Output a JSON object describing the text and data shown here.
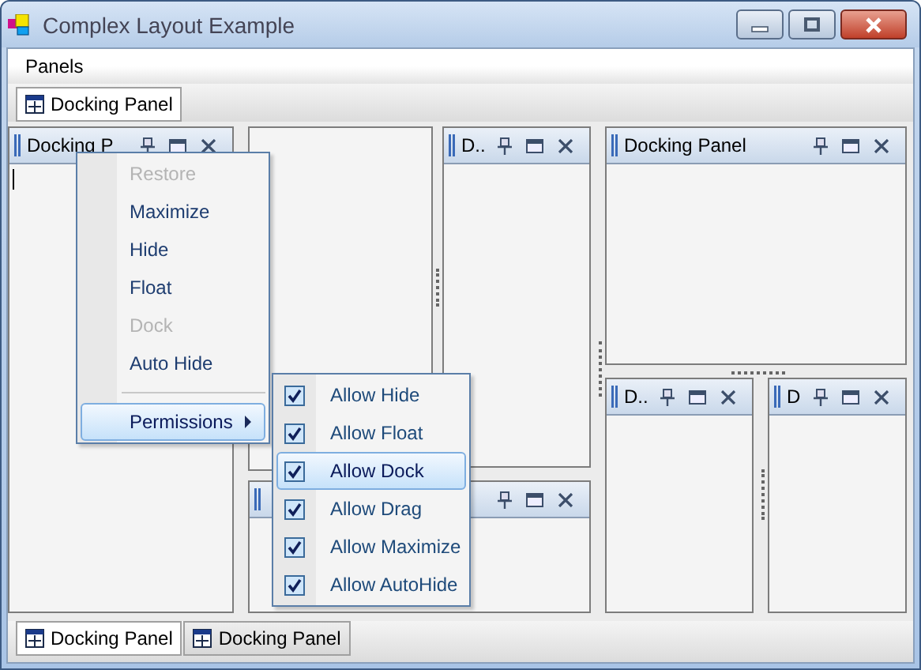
{
  "window": {
    "title": "Complex Layout Example"
  },
  "menu_bar": [
    {
      "label": "Panels"
    }
  ],
  "top_tabs": [
    {
      "label": "Docking Panel"
    }
  ],
  "panels": [
    {
      "kind": "tool",
      "title": "Docking P",
      "caret": true
    },
    {
      "kind": "document"
    },
    {
      "kind": "tool"
    },
    {
      "kind": "tool",
      "title": "D.."
    },
    {
      "kind": "tool",
      "title": "Docking Panel"
    },
    {
      "kind": "tool",
      "title": "D.."
    },
    {
      "kind": "tool",
      "title": "D"
    }
  ],
  "context_menu": {
    "items": [
      {
        "kind": "item",
        "label": "Restore",
        "disabled": true,
        "selected": false
      },
      {
        "kind": "item",
        "label": "Maximize",
        "disabled": false,
        "selected": false
      },
      {
        "kind": "item",
        "label": "Hide",
        "disabled": false,
        "selected": false
      },
      {
        "kind": "item",
        "label": "Float",
        "disabled": false,
        "selected": false
      },
      {
        "kind": "item",
        "label": "Dock",
        "disabled": true,
        "selected": false
      },
      {
        "kind": "item",
        "label": "Auto Hide",
        "disabled": false,
        "selected": false
      },
      {
        "kind": "separator"
      },
      {
        "kind": "submenu",
        "label": "Permissions",
        "disabled": false,
        "selected": true
      }
    ]
  },
  "submenu": {
    "items": [
      {
        "label": "Allow Hide",
        "checked": true,
        "selected": false
      },
      {
        "label": "Allow Float",
        "checked": true,
        "selected": false
      },
      {
        "label": "Allow Dock",
        "checked": true,
        "selected": true
      },
      {
        "label": "Allow Drag",
        "checked": true,
        "selected": false
      },
      {
        "label": "Allow Maximize",
        "checked": true,
        "selected": false
      },
      {
        "label": "Allow AutoHide",
        "checked": true,
        "selected": false
      }
    ]
  },
  "bottom_tabs": [
    {
      "label": "Docking Panel",
      "selected": true
    },
    {
      "label": "Docking Panel",
      "selected": false
    }
  ]
}
